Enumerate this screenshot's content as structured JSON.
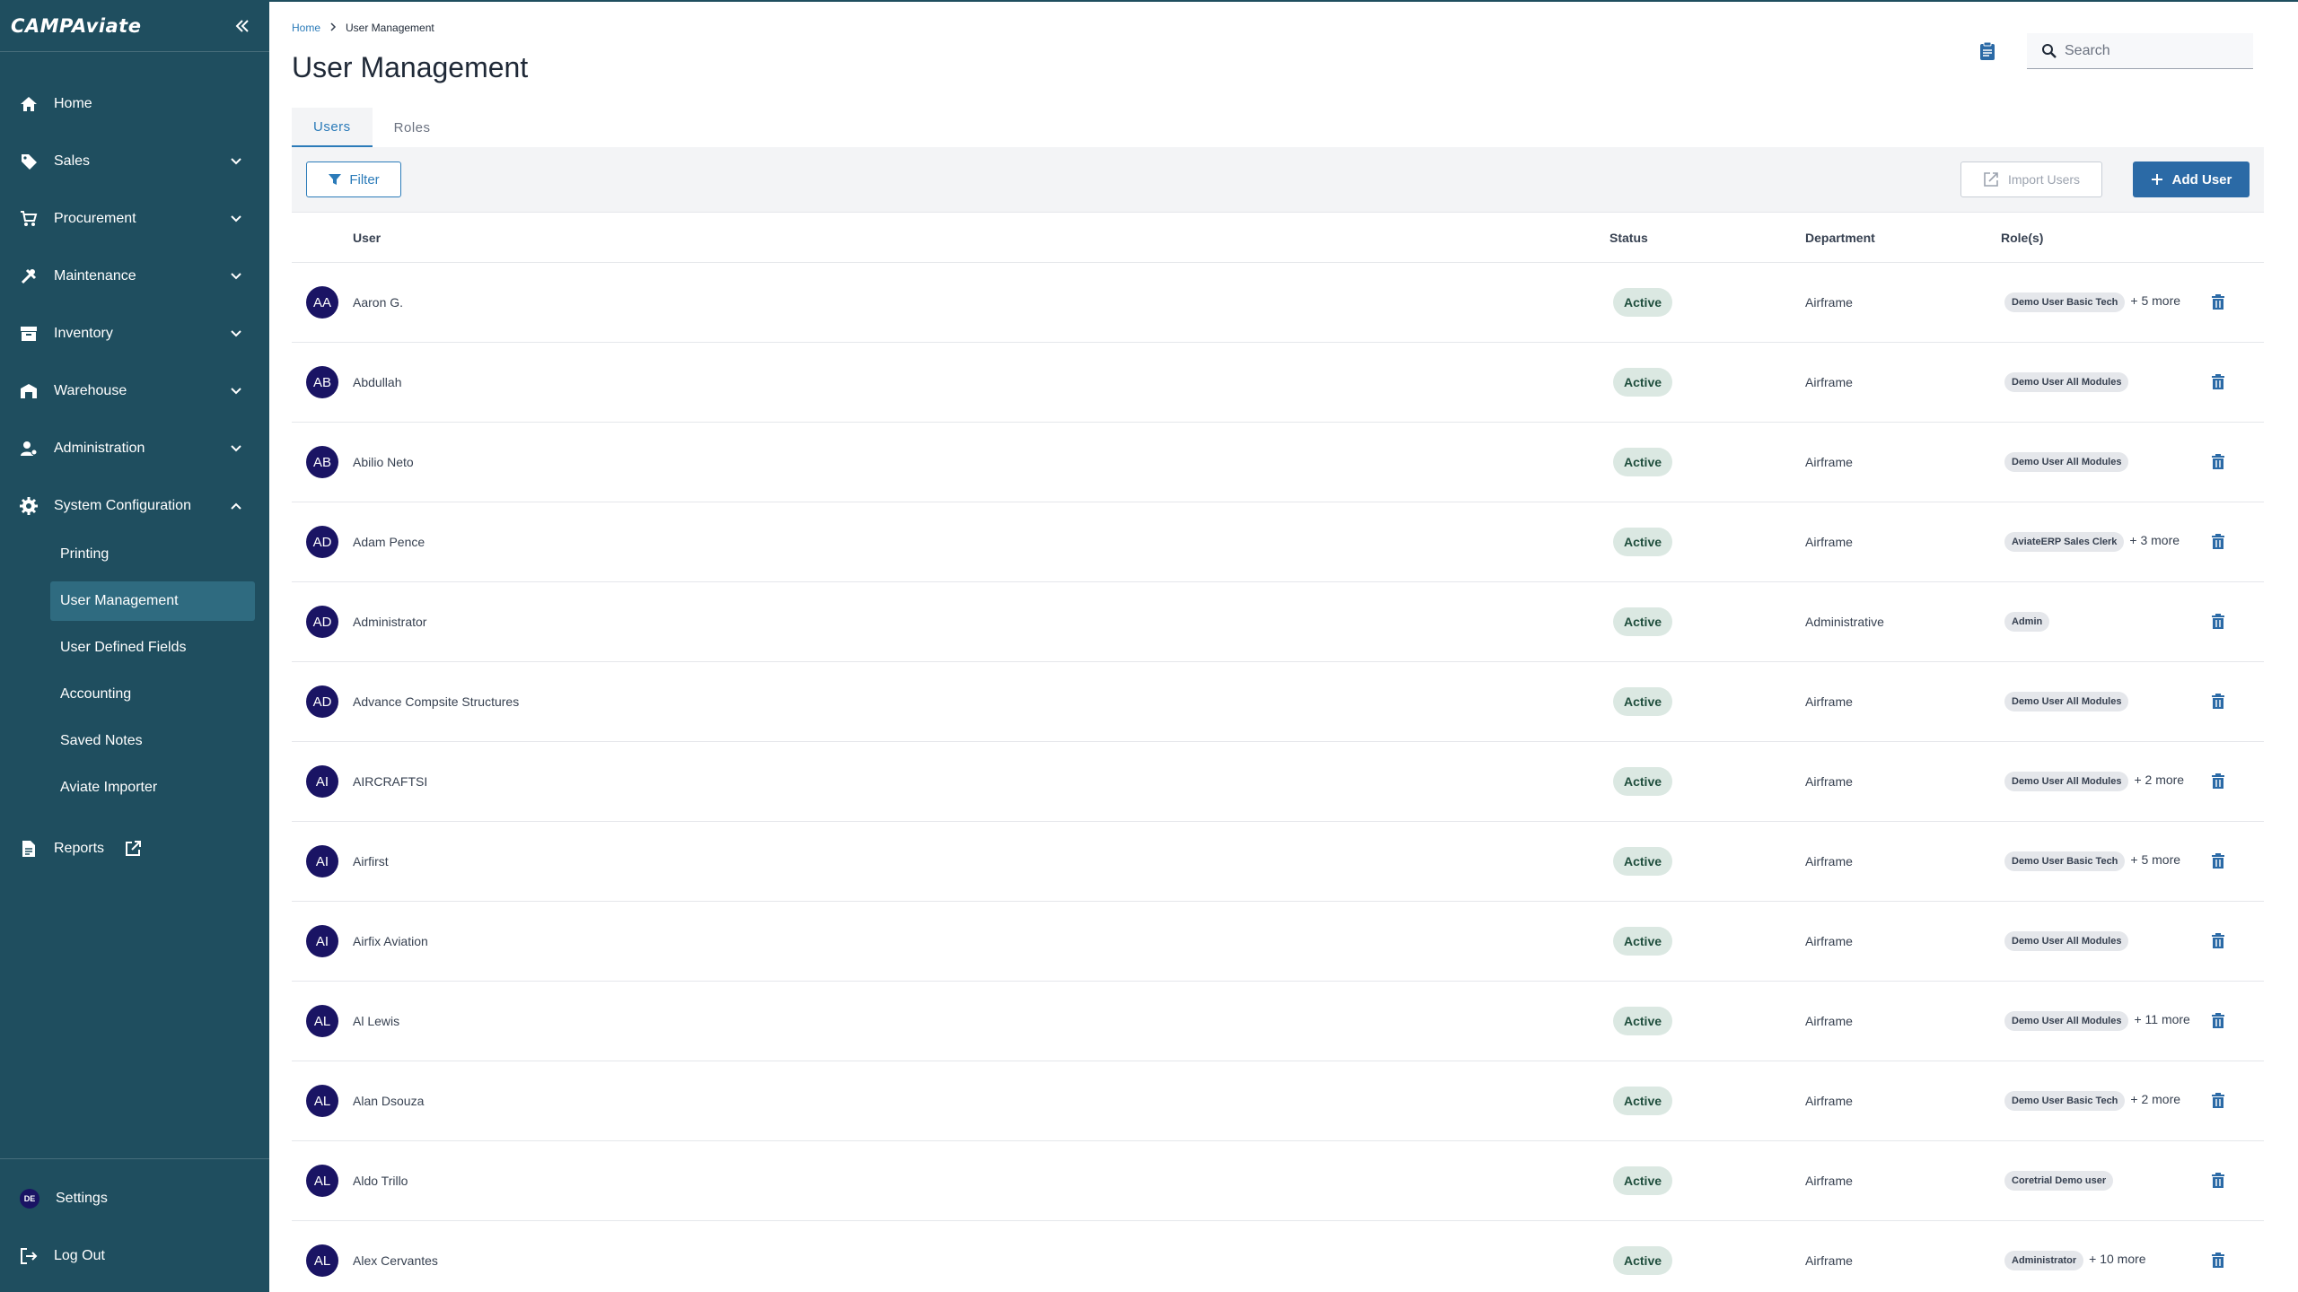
{
  "sidebar": {
    "logo": "CAMPAviate",
    "items": [
      {
        "label": "Home",
        "icon": "home-icon"
      },
      {
        "label": "Sales",
        "icon": "tag-icon"
      },
      {
        "label": "Procurement",
        "icon": "cart-icon"
      },
      {
        "label": "Maintenance",
        "icon": "tools-icon"
      },
      {
        "label": "Inventory",
        "icon": "archive-icon"
      },
      {
        "label": "Warehouse",
        "icon": "warehouse-icon"
      },
      {
        "label": "Administration",
        "icon": "admin-icon"
      },
      {
        "label": "System Configuration",
        "icon": "gear-icon"
      }
    ],
    "sub_items": [
      "Printing",
      "User Management",
      "User Defined Fields",
      "Accounting",
      "Saved Notes",
      "Aviate Importer"
    ],
    "reports": "Reports",
    "settings": "Settings",
    "settings_avatar": "DE",
    "logout": "Log Out"
  },
  "breadcrumb": {
    "home": "Home",
    "separator": ">",
    "current": "User Management"
  },
  "page": {
    "title": "User Management"
  },
  "search": {
    "placeholder": "Search"
  },
  "tabs": [
    {
      "label": "Users",
      "active": true
    },
    {
      "label": "Roles",
      "active": false
    }
  ],
  "toolbar": {
    "filter": "Filter",
    "import": "Import Users",
    "add": "Add User"
  },
  "table": {
    "headers": {
      "user": "User",
      "status": "Status",
      "department": "Department",
      "roles": "Role(s)"
    },
    "rows": [
      {
        "initials": "AA",
        "name": "Aaron G.",
        "status": "Active",
        "department": "Airframe",
        "role": "Demo User Basic Tech",
        "more": "+ 5 more"
      },
      {
        "initials": "AB",
        "name": "Abdullah",
        "status": "Active",
        "department": "Airframe",
        "role": "Demo User All Modules",
        "more": ""
      },
      {
        "initials": "AB",
        "name": "Abilio Neto",
        "status": "Active",
        "department": "Airframe",
        "role": "Demo User All Modules",
        "more": ""
      },
      {
        "initials": "AD",
        "name": "Adam Pence",
        "status": "Active",
        "department": "Airframe",
        "role": "AviateERP Sales Clerk",
        "more": "+ 3 more"
      },
      {
        "initials": "AD",
        "name": "Administrator",
        "status": "Active",
        "department": "Administrative",
        "role": "Admin",
        "more": ""
      },
      {
        "initials": "AD",
        "name": "Advance Compsite Structures",
        "status": "Active",
        "department": "Airframe",
        "role": "Demo User All Modules",
        "more": ""
      },
      {
        "initials": "AI",
        "name": "AIRCRAFTSI",
        "status": "Active",
        "department": "Airframe",
        "role": "Demo User All Modules",
        "more": "+ 2 more"
      },
      {
        "initials": "AI",
        "name": "Airfirst",
        "status": "Active",
        "department": "Airframe",
        "role": "Demo User Basic Tech",
        "more": "+ 5 more"
      },
      {
        "initials": "AI",
        "name": "Airfix Aviation",
        "status": "Active",
        "department": "Airframe",
        "role": "Demo User All Modules",
        "more": ""
      },
      {
        "initials": "AL",
        "name": "Al Lewis",
        "status": "Active",
        "department": "Airframe",
        "role": "Demo User All Modules",
        "more": "+ 11 more"
      },
      {
        "initials": "AL",
        "name": "Alan Dsouza",
        "status": "Active",
        "department": "Airframe",
        "role": "Demo User Basic Tech",
        "more": "+ 2 more"
      },
      {
        "initials": "AL",
        "name": "Aldo Trillo",
        "status": "Active",
        "department": "Airframe",
        "role": "Coretrial Demo user",
        "more": ""
      },
      {
        "initials": "AL",
        "name": "Alex Cervantes",
        "status": "Active",
        "department": "Airframe",
        "role": "Administrator",
        "more": "+ 10 more"
      }
    ]
  },
  "colors": {
    "sidebar": "#1f4e5f",
    "sidebar_active": "#2f6b80",
    "accent": "#2b7bb9",
    "primary_button": "#2b6aa6",
    "avatar": "#1a1464",
    "status_bg": "#dbe8e2"
  }
}
